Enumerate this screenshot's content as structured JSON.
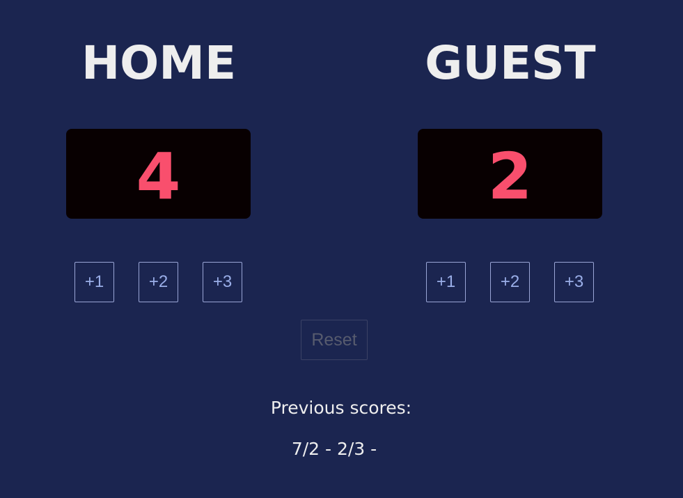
{
  "home": {
    "title": "HOME",
    "score": "4",
    "buttons": [
      "+1",
      "+2",
      "+3"
    ]
  },
  "guest": {
    "title": "GUEST",
    "score": "2",
    "buttons": [
      "+1",
      "+2",
      "+3"
    ]
  },
  "reset_label": "Reset",
  "previous_scores": {
    "label": "Previous scores:",
    "values": "7/2 - 2/3 -"
  },
  "colors": {
    "background": "#1b2550",
    "score_box": "#080001",
    "score_text": "#f94f6d",
    "title_text": "#eeeeee",
    "button_text": "#9aaee8",
    "reset_text": "#575b6e"
  }
}
